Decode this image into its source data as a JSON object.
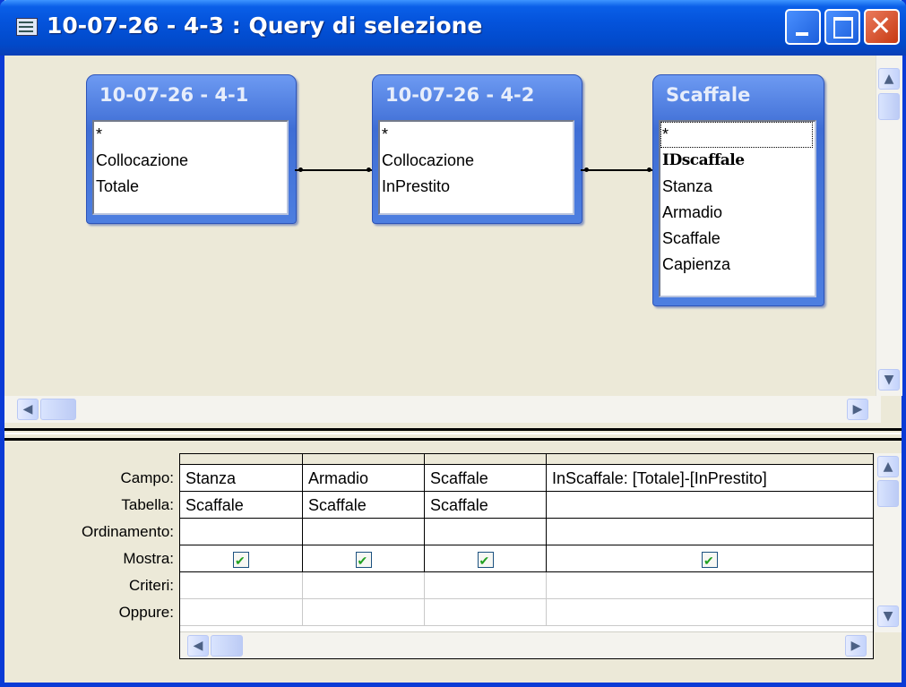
{
  "window": {
    "title": "10-07-26 - 4-3 : Query di selezione",
    "controls": {
      "minimize": "_",
      "maximize": "□",
      "close": "✕"
    }
  },
  "tables": [
    {
      "name": "10-07-26 - 4-1",
      "fields": [
        "*",
        "Collocazione",
        "Totale"
      ]
    },
    {
      "name": "10-07-26 - 4-2",
      "fields": [
        "*",
        "Collocazione",
        "InPrestito"
      ]
    },
    {
      "name": "Scaffale",
      "fields": [
        "*",
        "IDscaffale",
        "Stanza",
        "Armadio",
        "Scaffale",
        "Capienza"
      ],
      "primary_key": "IDscaffale"
    }
  ],
  "grid": {
    "row_labels": [
      "Campo:",
      "Tabella:",
      "Ordinamento:",
      "Mostra:",
      "Criteri:",
      "Oppure:"
    ],
    "columns": [
      {
        "campo": "Stanza",
        "tabella": "Scaffale",
        "ordinamento": "",
        "mostra": true,
        "criteri": "",
        "oppure": ""
      },
      {
        "campo": "Armadio",
        "tabella": "Scaffale",
        "ordinamento": "",
        "mostra": true,
        "criteri": "",
        "oppure": ""
      },
      {
        "campo": "Scaffale",
        "tabella": "Scaffale",
        "ordinamento": "",
        "mostra": true,
        "criteri": "",
        "oppure": ""
      },
      {
        "campo": "InScaffale: [Totale]-[InPrestito]",
        "tabella": "",
        "ordinamento": "",
        "mostra": true,
        "criteri": "",
        "oppure": ""
      }
    ]
  },
  "scroll_icons": {
    "up": "chevron-up-icon",
    "down": "chevron-down-icon",
    "left": "chevron-left-icon",
    "right": "chevron-right-icon"
  }
}
